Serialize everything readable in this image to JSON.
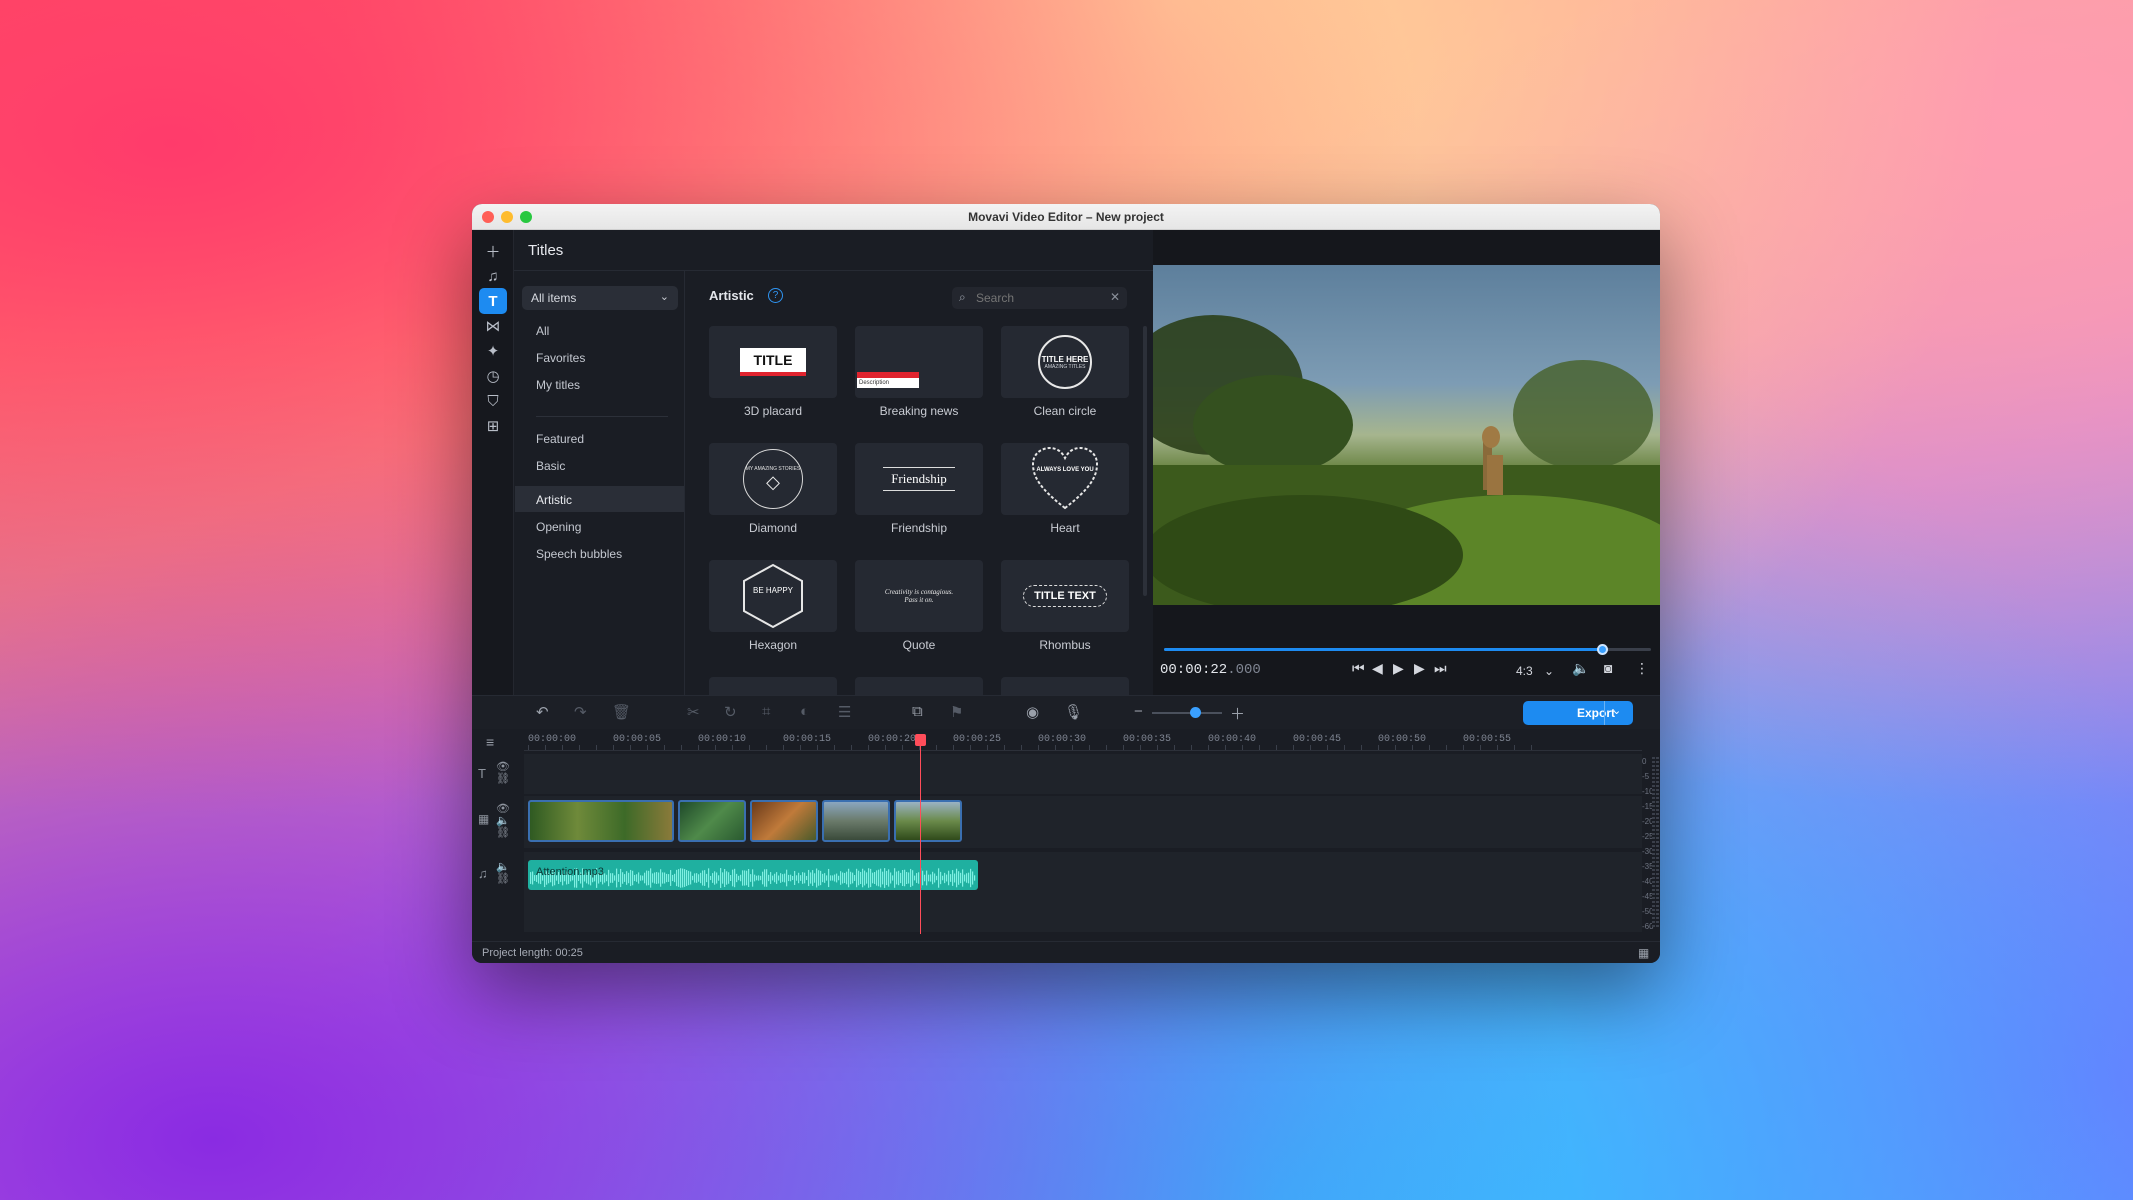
{
  "window": {
    "title": "Movavi Video Editor – New project"
  },
  "panel": {
    "title": "Titles"
  },
  "dropdown": {
    "value": "All items"
  },
  "categories": [
    {
      "label": "All"
    },
    {
      "label": "Favorites"
    },
    {
      "label": "My titles"
    },
    {
      "label": "Featured"
    },
    {
      "label": "Basic"
    },
    {
      "label": "Artistic"
    },
    {
      "label": "Opening"
    },
    {
      "label": "Speech bubbles"
    }
  ],
  "section": {
    "title": "Artistic",
    "help": "?"
  },
  "search": {
    "placeholder": "Search"
  },
  "tiles": [
    {
      "label": "3D placard",
      "preview_text": "TITLE"
    },
    {
      "label": "Breaking news",
      "preview_text": "Description"
    },
    {
      "label": "Clean circle",
      "preview_text": "TITLE HERE",
      "preview_sub": "AMAZING TITLES"
    },
    {
      "label": "Diamond",
      "preview_text": "MY AMAZING STORIES"
    },
    {
      "label": "Friendship",
      "preview_text": "Friendship"
    },
    {
      "label": "Heart",
      "preview_text": "ALWAYS LOVE YOU"
    },
    {
      "label": "Hexagon",
      "preview_text": "BE HAPPY"
    },
    {
      "label": "Quote",
      "preview_text": "Creativity is contagious. Pass it on."
    },
    {
      "label": "Rhombus",
      "preview_text": "TITLE TEXT"
    }
  ],
  "player": {
    "timecode": "00:00:22",
    "timecode_ms": ".000",
    "aspect": "4:3",
    "seek_fraction": 0.9
  },
  "export": {
    "label": "Export"
  },
  "ruler": [
    "00:00:00",
    "00:00:05",
    "00:00:10",
    "00:00:15",
    "00:00:20",
    "00:00:25",
    "00:00:30",
    "00:00:35",
    "00:00:40",
    "00:00:45",
    "00:00:50",
    "00:00:55"
  ],
  "audio": {
    "clip_name": "Attention.mp3"
  },
  "meter": [
    "0",
    "-5",
    "-10",
    "-15",
    "-20",
    "-25",
    "-30",
    "-35",
    "-40",
    "-45",
    "-50",
    "-60"
  ],
  "status": {
    "project_length": "Project length: 00:25"
  },
  "colors": {
    "accent": "#1d8bf1",
    "playhead": "#ff4d5a",
    "audio": "#1fb0a0"
  }
}
